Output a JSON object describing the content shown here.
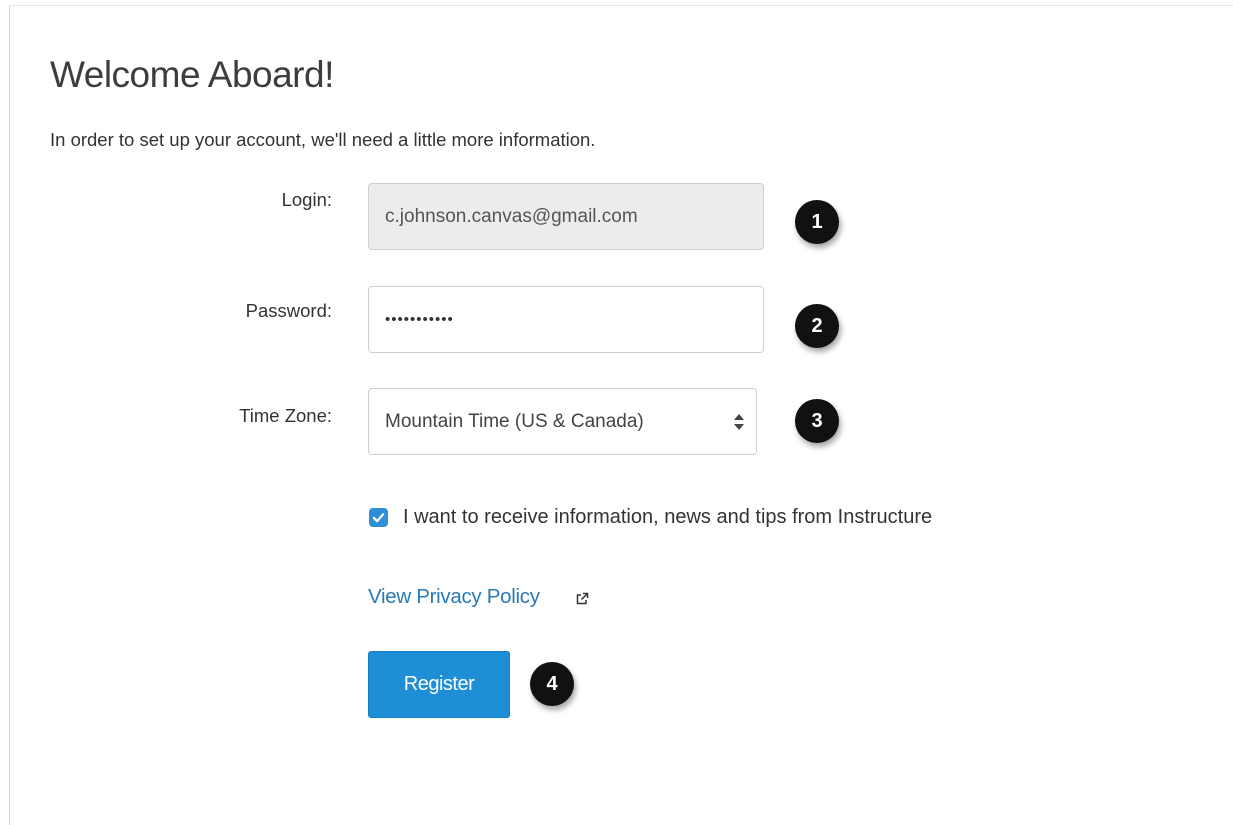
{
  "header": {
    "title": "Welcome Aboard!",
    "subtitle": "In order to set up your account, we'll need a little more information."
  },
  "form": {
    "login": {
      "label": "Login:",
      "value": "c.johnson.canvas@gmail.com",
      "badge": "1"
    },
    "password": {
      "label": "Password:",
      "value": "•••••••••••",
      "badge": "2"
    },
    "timezone": {
      "label": "Time Zone:",
      "value": "Mountain Time (US & Canada)",
      "badge": "3"
    },
    "newsletter": {
      "checked": true,
      "label": "I want to receive information, news and tips from Instructure"
    },
    "privacy_link": "View Privacy Policy",
    "register": {
      "label": "Register",
      "badge": "4"
    }
  },
  "colors": {
    "accent": "#1e8ed6",
    "link": "#2a7ab9",
    "badge": "#111111",
    "readonly_field": "#ececec"
  }
}
